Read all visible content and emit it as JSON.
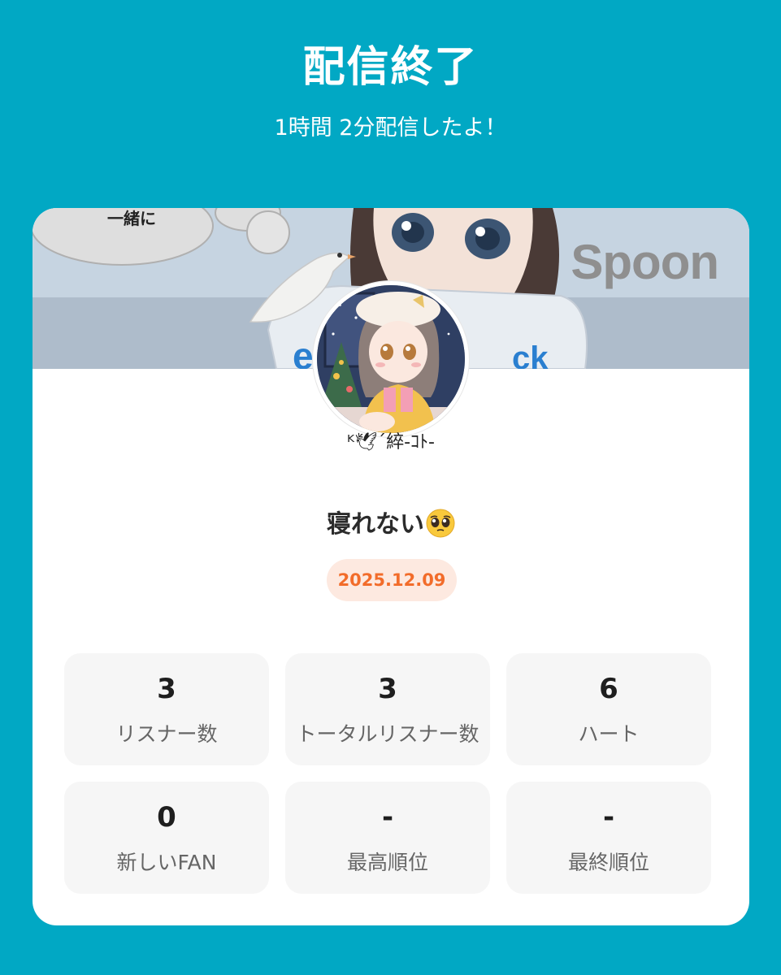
{
  "header": {
    "title": "配信終了",
    "subtitle": "1時間 2分配信したよ！"
  },
  "banner": {
    "logo_text": "Spoon",
    "cloud_text": "一緒に"
  },
  "profile": {
    "username": "ᴷ🕊´綷-ｺﾄ-",
    "stream_title": "寝れない",
    "stream_title_emoji": "pleading-face-emoji",
    "date": "2025.12.09"
  },
  "stats": [
    {
      "value": "3",
      "label": "リスナー数"
    },
    {
      "value": "3",
      "label": "トータルリスナー数"
    },
    {
      "value": "6",
      "label": "ハート"
    },
    {
      "value": "0",
      "label": "新しいFAN"
    },
    {
      "value": "-",
      "label": "最高順位"
    },
    {
      "value": "-",
      "label": "最終順位"
    }
  ],
  "colors": {
    "background": "#01a8c4",
    "card": "#ffffff",
    "date_text": "#f26c2a",
    "date_badge": "#fde9e0",
    "stat_box": "#f6f6f6"
  }
}
